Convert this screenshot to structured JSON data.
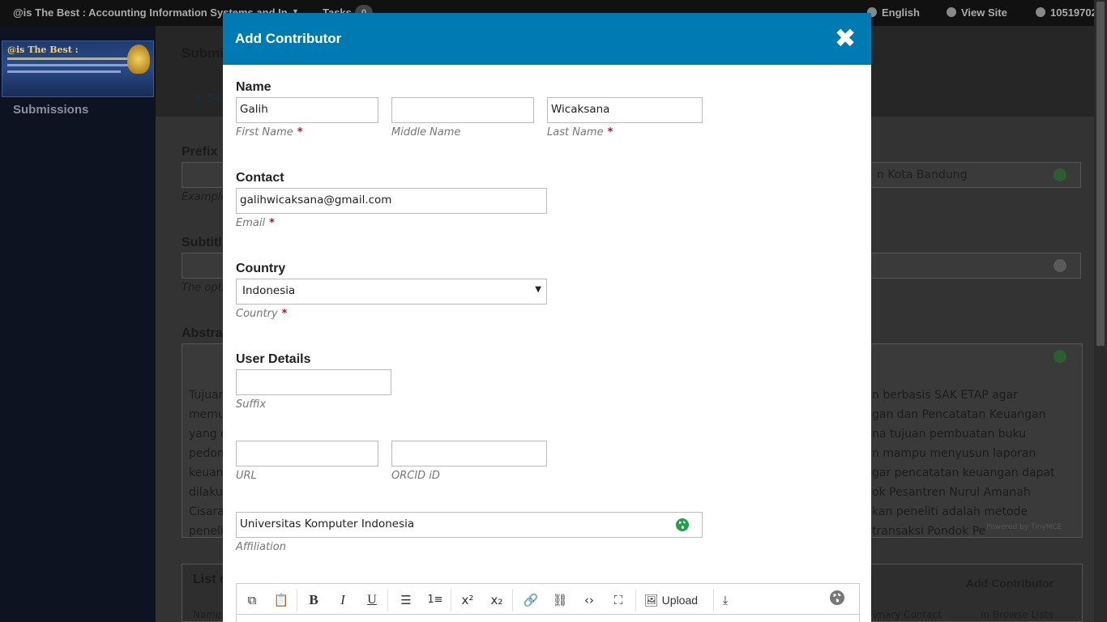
{
  "topbar": {
    "site_name": "@is The Best : Accounting Information Systems and In...",
    "tasks_label": "Tasks",
    "tasks_count": "0",
    "language": "English",
    "view_site": "View Site",
    "user": "10519702"
  },
  "sidebar": {
    "logo_text": "@is The Best :",
    "nav_submissions": "Submissions"
  },
  "background": {
    "page_title": "Submi",
    "step": "1. Sta",
    "prefix_label": "Prefix",
    "prefix_hint": "Example",
    "prefix_right_text": "n Kota Bandung",
    "subtitle_label": "Subtitl",
    "subtitle_hint": "The opti",
    "abstract_label": "Abstra",
    "abstract_left_lines": [
      "Tujuan",
      "memu",
      "yang d",
      "pedom",
      "keuan",
      "dilaku",
      "Cisara",
      "peneli"
    ],
    "abstract_right_lines": [
      "n berbasis SAK ETAP agar",
      "gan dan Pencatatan Keuangan",
      "na tujuan pembuatan buku",
      "n mampu menyusun laporan",
      "gar pencatatan keuangan dapat",
      "ok Pesantren Nurul Amanah",
      "kan peneliti adalah metode",
      "transaksi Pondok Pe"
    ],
    "powered_by": "Powered by TinyMCE",
    "list_label": "List c",
    "add_contributor_link": "Add Contributor",
    "col_name": "Name",
    "col_primary": "rimary Contact",
    "col_browse": "In Browse Lists"
  },
  "modal": {
    "title": "Add Contributor",
    "close_symbol": "✖",
    "name_section": "Name",
    "first_name_value": "Galih",
    "first_name_label": "First Name",
    "middle_name_value": "",
    "middle_name_label": "Middle Name",
    "last_name_value": "Wicaksana",
    "last_name_label": "Last Name",
    "required_mark": "*",
    "contact_section": "Contact",
    "email_value": "galihwicaksana@gmail.com",
    "email_label": "Email",
    "country_section": "Country",
    "country_value": "Indonesia",
    "country_label": "Country",
    "user_details_section": "User Details",
    "suffix_value": "",
    "suffix_label": "Suffix",
    "url_value": "",
    "url_label": "URL",
    "orcid_value": "",
    "orcid_label": "ORCID iD",
    "affiliation_value": "Universitas Komputer Indonesia",
    "affiliation_label": "Affiliation",
    "upload_label": "Upload"
  },
  "colors": {
    "header_blue": "#007ab2",
    "required_red": "#d00036",
    "globe_green": "#1fa34a"
  }
}
